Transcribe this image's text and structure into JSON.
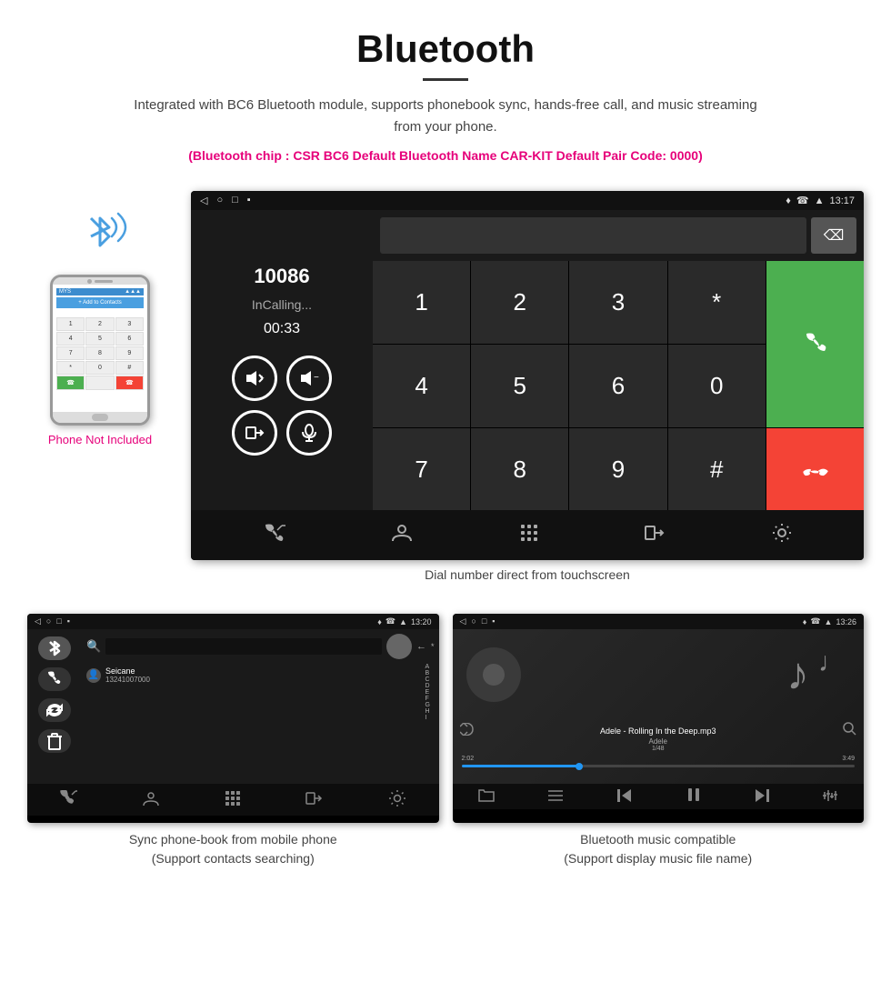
{
  "header": {
    "title": "Bluetooth",
    "description": "Integrated with BC6 Bluetooth module, supports phonebook sync, hands-free call, and music streaming from your phone.",
    "specs": "(Bluetooth chip : CSR BC6    Default Bluetooth Name CAR-KIT    Default Pair Code: 0000)"
  },
  "phone_label": "Phone Not Included",
  "large_screen": {
    "status": {
      "left": [
        "◁",
        "○",
        "□",
        "▪"
      ],
      "right": "13:17",
      "icons": [
        "♦",
        "☎",
        "▲"
      ]
    },
    "call": {
      "number": "10086",
      "status": "InCalling...",
      "timer": "00:33"
    },
    "dialpad": {
      "keys": [
        "1",
        "2",
        "3",
        "*",
        "4",
        "5",
        "6",
        "0",
        "7",
        "8",
        "9",
        "#"
      ]
    },
    "caption": "Dial number direct from touchscreen"
  },
  "bottom_left": {
    "status": {
      "left": [
        "◁",
        "○",
        "□",
        "▪"
      ],
      "right": "13:20",
      "icons": [
        "♦",
        "☎",
        "▲"
      ]
    },
    "contact": {
      "name": "Seicane",
      "number": "13241007000"
    },
    "caption": "Sync phone-book from mobile phone\n(Support contacts searching)"
  },
  "bottom_right": {
    "status": {
      "left": [
        "◁",
        "○",
        "□",
        "▪"
      ],
      "right": "13:26",
      "icons": [
        "♦",
        "☎",
        "▲"
      ]
    },
    "music": {
      "title": "Adele - Rolling In the Deep.mp3",
      "artist": "Adele",
      "track": "1/48",
      "time_current": "2:02",
      "time_total": "3:49"
    },
    "caption": "Bluetooth music compatible\n(Support display music file name)"
  }
}
